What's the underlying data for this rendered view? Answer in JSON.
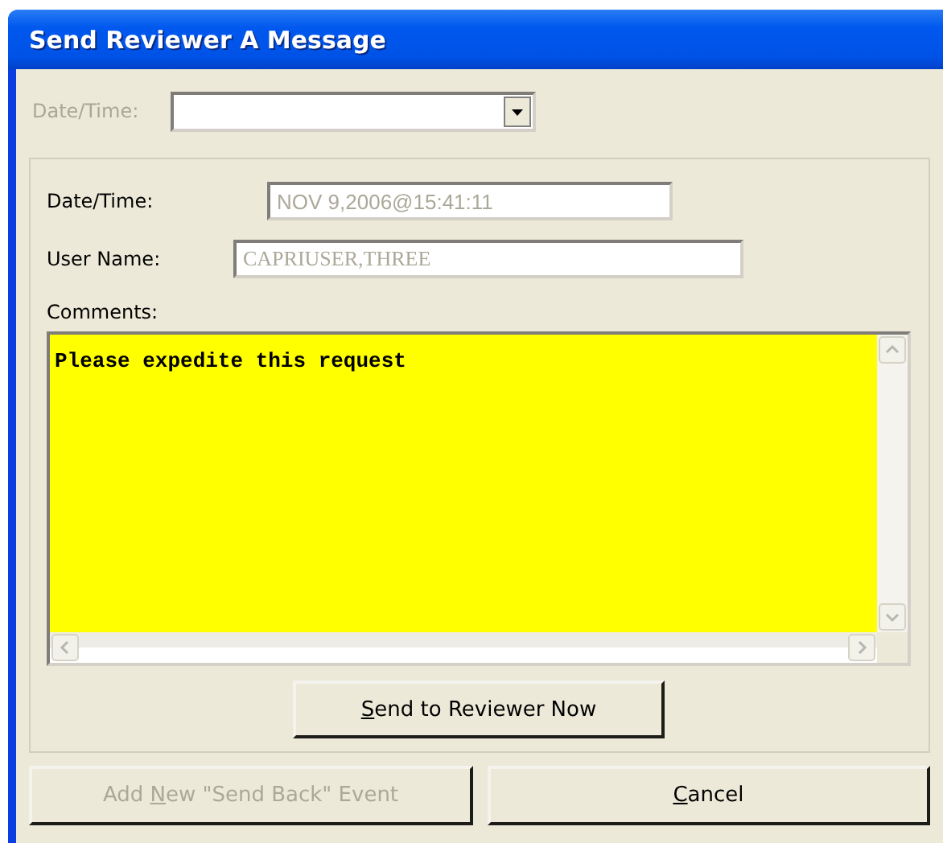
{
  "window": {
    "title": "Send Reviewer A Message"
  },
  "top_field": {
    "label": "Date/Time:",
    "disabled": true
  },
  "details": {
    "fields": [
      {
        "label": "Date/Time:",
        "value": "NOV 9,2006@15:41:11",
        "kind": "sans",
        "disabled": true
      },
      {
        "label": "User Name:",
        "value": "CAPRIUSER,THREE",
        "kind": "serif",
        "disabled": true
      }
    ],
    "comments": {
      "label": "Comments:",
      "value": "Please expedite this request"
    },
    "send_button": {
      "access_key": "S",
      "label_rest": "end to Reviewer Now"
    }
  },
  "buttons": [
    {
      "label_start": "Add ",
      "access_key": "N",
      "label_rest": "ew \"Send Back\" Event",
      "disabled": true
    },
    {
      "access_key": "C",
      "label_rest": "ancel",
      "disabled": false
    }
  ]
}
